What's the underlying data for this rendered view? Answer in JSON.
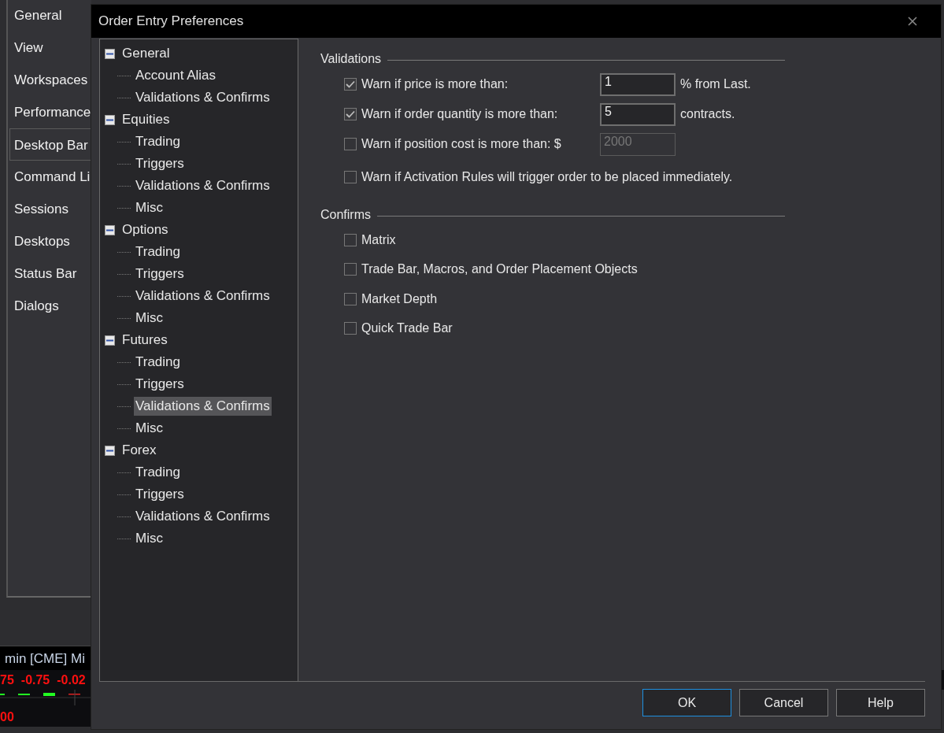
{
  "background": {
    "sidebar": {
      "items": [
        {
          "label": "General",
          "selected": false
        },
        {
          "label": "View",
          "selected": false
        },
        {
          "label": "Workspaces",
          "selected": false
        },
        {
          "label": "Performance",
          "selected": false
        },
        {
          "label": "Desktop Bar",
          "selected": true
        },
        {
          "label": "Command Li",
          "selected": false
        },
        {
          "label": "Sessions",
          "selected": false
        },
        {
          "label": "Desktops",
          "selected": false
        },
        {
          "label": "Status Bar",
          "selected": false
        },
        {
          "label": "Dialogs",
          "selected": false
        }
      ]
    },
    "chart_strip": {
      "title": "min [CME] Mi",
      "quotes": [
        "75",
        "-0.75",
        "-0.02"
      ],
      "price": "00"
    }
  },
  "dialog": {
    "title": "Order Entry Preferences",
    "tree": [
      {
        "label": "General",
        "expanded": true,
        "selected": false,
        "children": [
          {
            "label": "Account Alias",
            "selected": false
          },
          {
            "label": "Validations & Confirms",
            "selected": false
          }
        ]
      },
      {
        "label": "Equities",
        "expanded": true,
        "selected": false,
        "children": [
          {
            "label": "Trading",
            "selected": false
          },
          {
            "label": "Triggers",
            "selected": false
          },
          {
            "label": "Validations & Confirms",
            "selected": false
          },
          {
            "label": "Misc",
            "selected": false
          }
        ]
      },
      {
        "label": "Options",
        "expanded": true,
        "selected": false,
        "children": [
          {
            "label": "Trading",
            "selected": false
          },
          {
            "label": "Triggers",
            "selected": false
          },
          {
            "label": "Validations & Confirms",
            "selected": false
          },
          {
            "label": "Misc",
            "selected": false
          }
        ]
      },
      {
        "label": "Futures",
        "expanded": true,
        "selected": false,
        "children": [
          {
            "label": "Trading",
            "selected": false
          },
          {
            "label": "Triggers",
            "selected": false
          },
          {
            "label": "Validations & Confirms",
            "selected": true
          },
          {
            "label": "Misc",
            "selected": false
          }
        ]
      },
      {
        "label": "Forex",
        "expanded": true,
        "selected": false,
        "children": [
          {
            "label": "Trading",
            "selected": false
          },
          {
            "label": "Triggers",
            "selected": false
          },
          {
            "label": "Validations & Confirms",
            "selected": false
          },
          {
            "label": "Misc",
            "selected": false
          }
        ]
      }
    ],
    "validations": {
      "title": "Validations",
      "rows": [
        {
          "label": "Warn if price is more than:",
          "checked": true,
          "value": "1",
          "disabled": false,
          "suffix": "% from Last."
        },
        {
          "label": "Warn if order quantity is more than:",
          "checked": true,
          "value": "5",
          "disabled": false,
          "suffix": "contracts."
        },
        {
          "label": "Warn if position cost is more than: $",
          "checked": false,
          "value": "2000",
          "disabled": true
        },
        {
          "label": "Warn if Activation Rules will trigger order to be placed immediately.",
          "checked": false
        }
      ]
    },
    "confirms": {
      "title": "Confirms",
      "items": [
        {
          "label": "Matrix",
          "checked": false
        },
        {
          "label": "Trade Bar, Macros, and Order Placement Objects",
          "checked": false
        },
        {
          "label": "Market Depth",
          "checked": false
        },
        {
          "label": "Quick Trade Bar",
          "checked": false
        }
      ]
    },
    "buttons": [
      {
        "label": "OK",
        "focused": true
      },
      {
        "label": "Cancel",
        "focused": false
      },
      {
        "label": "Help",
        "focused": false
      }
    ]
  }
}
